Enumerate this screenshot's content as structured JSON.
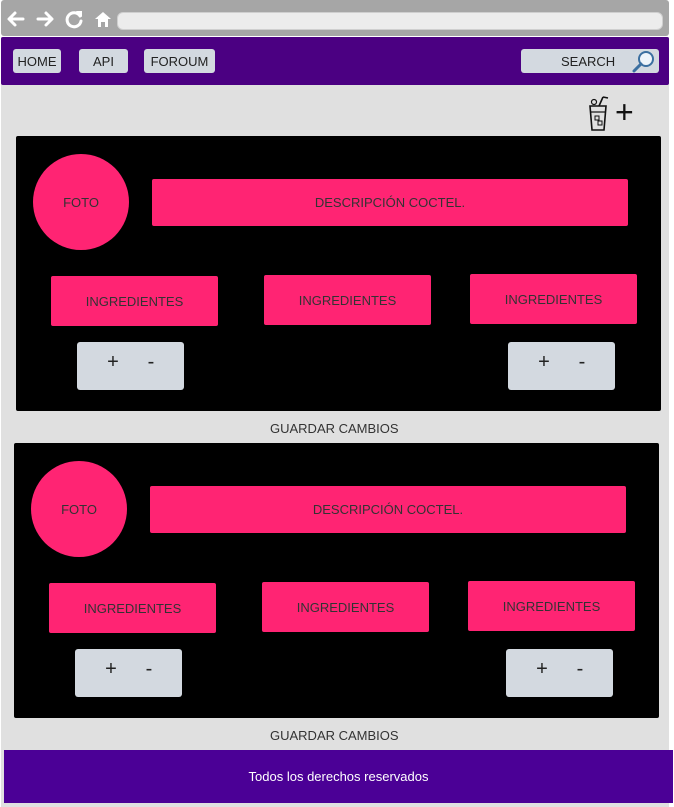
{
  "nav": {
    "home": "HOME",
    "api": "API",
    "forum": "FOROUM",
    "search": "SEARCH"
  },
  "cards": [
    {
      "foto": "FOTO",
      "descripcion": "DESCRIPCIÓN COCTEL.",
      "ingredientes": [
        "INGREDIENTES",
        "INGREDIENTES",
        "INGREDIENTES"
      ],
      "stepper_plus": "+",
      "stepper_minus": "-",
      "save": "GUARDAR CAMBIOS"
    },
    {
      "foto": "FOTO",
      "descripcion": "DESCRIPCIÓN COCTEL.",
      "ingredientes": [
        "INGREDIENTES",
        "INGREDIENTES",
        "INGREDIENTES"
      ],
      "stepper_plus": "+",
      "stepper_minus": "-",
      "save": "GUARDAR CAMBIOS"
    }
  ],
  "add_button": "+",
  "footer": "Todos los derechos reservados",
  "colors": {
    "navbar": "#4b0082",
    "footer": "#4b0096",
    "accent": "#ff2473",
    "card": "#000000",
    "control": "#d3d9e0"
  }
}
